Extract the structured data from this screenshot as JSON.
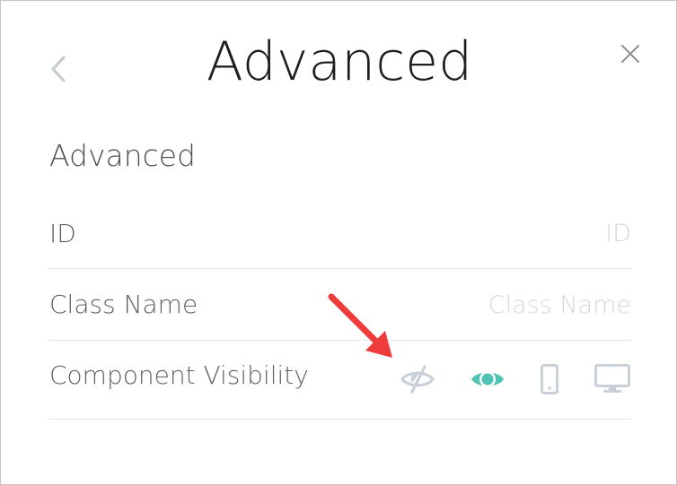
{
  "header": {
    "title": "Advanced",
    "back_icon": "chevron-left-icon",
    "close_icon": "close-icon"
  },
  "section": {
    "title": "Advanced"
  },
  "fields": {
    "id": {
      "label": "ID",
      "value": "",
      "placeholder": "ID"
    },
    "class_name": {
      "label": "Class Name",
      "value": "",
      "placeholder": "Class Name"
    }
  },
  "visibility": {
    "label": "Component Visibility",
    "options": [
      {
        "icon": "eye-slash-icon",
        "state": "inactive"
      },
      {
        "icon": "eye-icon",
        "state": "active"
      },
      {
        "icon": "mobile-icon",
        "state": "inactive"
      },
      {
        "icon": "desktop-icon",
        "state": "inactive"
      }
    ]
  },
  "colors": {
    "active_icon": "#4fc3b5",
    "inactive_icon": "#c9d0d7",
    "annotation_arrow": "#ee3b3b",
    "title_text": "#1f1f1f",
    "label_text": "#5d6268",
    "placeholder_text": "#d4d8dd",
    "divider": "#e3e5e8"
  }
}
